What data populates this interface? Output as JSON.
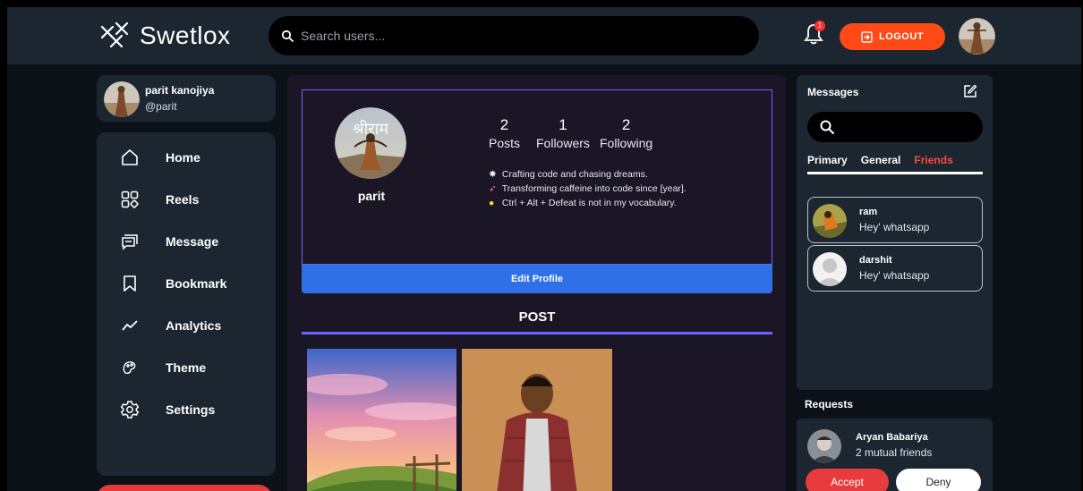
{
  "app": {
    "name": "Swetlox"
  },
  "search": {
    "placeholder": "Search users..."
  },
  "header": {
    "notification_count": "1",
    "logout_label": "LOGOUT"
  },
  "user": {
    "name": "parit kanojiya",
    "handle": "@parit"
  },
  "nav": {
    "items": [
      {
        "label": "Home",
        "icon": "home-icon"
      },
      {
        "label": "Reels",
        "icon": "reels-icon"
      },
      {
        "label": "Message",
        "icon": "message-icon"
      },
      {
        "label": "Bookmark",
        "icon": "bookmark-icon"
      },
      {
        "label": "Analytics",
        "icon": "analytics-icon"
      },
      {
        "label": "Theme",
        "icon": "theme-icon"
      },
      {
        "label": "Settings",
        "icon": "settings-icon"
      }
    ]
  },
  "profile": {
    "name": "parit",
    "avatar_text": "श्रीराम",
    "stats": {
      "posts": {
        "value": "2",
        "label": "Posts"
      },
      "followers": {
        "value": "1",
        "label": "Followers"
      },
      "following": {
        "value": "2",
        "label": "Following"
      }
    },
    "bio": [
      "Crafting code and chasing dreams.",
      "Transforming caffeine into code since [year].",
      "Ctrl + Alt + Defeat is not in my vocabulary."
    ],
    "edit_label": "Edit Profile"
  },
  "posts": {
    "title": "POST"
  },
  "messages": {
    "title": "Messages",
    "tabs": [
      "Primary",
      "General",
      "Friends"
    ],
    "active_tab": "Friends",
    "chats": [
      {
        "name": "ram",
        "message": "Hey' whatsapp"
      },
      {
        "name": "darshit",
        "message": "Hey' whatsapp"
      }
    ]
  },
  "requests": {
    "title": "Requests",
    "items": [
      {
        "name": "Aryan Babariya",
        "mutual": "2 mutual friends",
        "accept_label": "Accept",
        "deny_label": "Deny"
      }
    ]
  },
  "colors": {
    "accent": "#6c63ff",
    "logout": "#ff4a16",
    "edit": "#2f6fe8",
    "active_tab": "#ff4a3c",
    "panel": "#1c2631"
  }
}
